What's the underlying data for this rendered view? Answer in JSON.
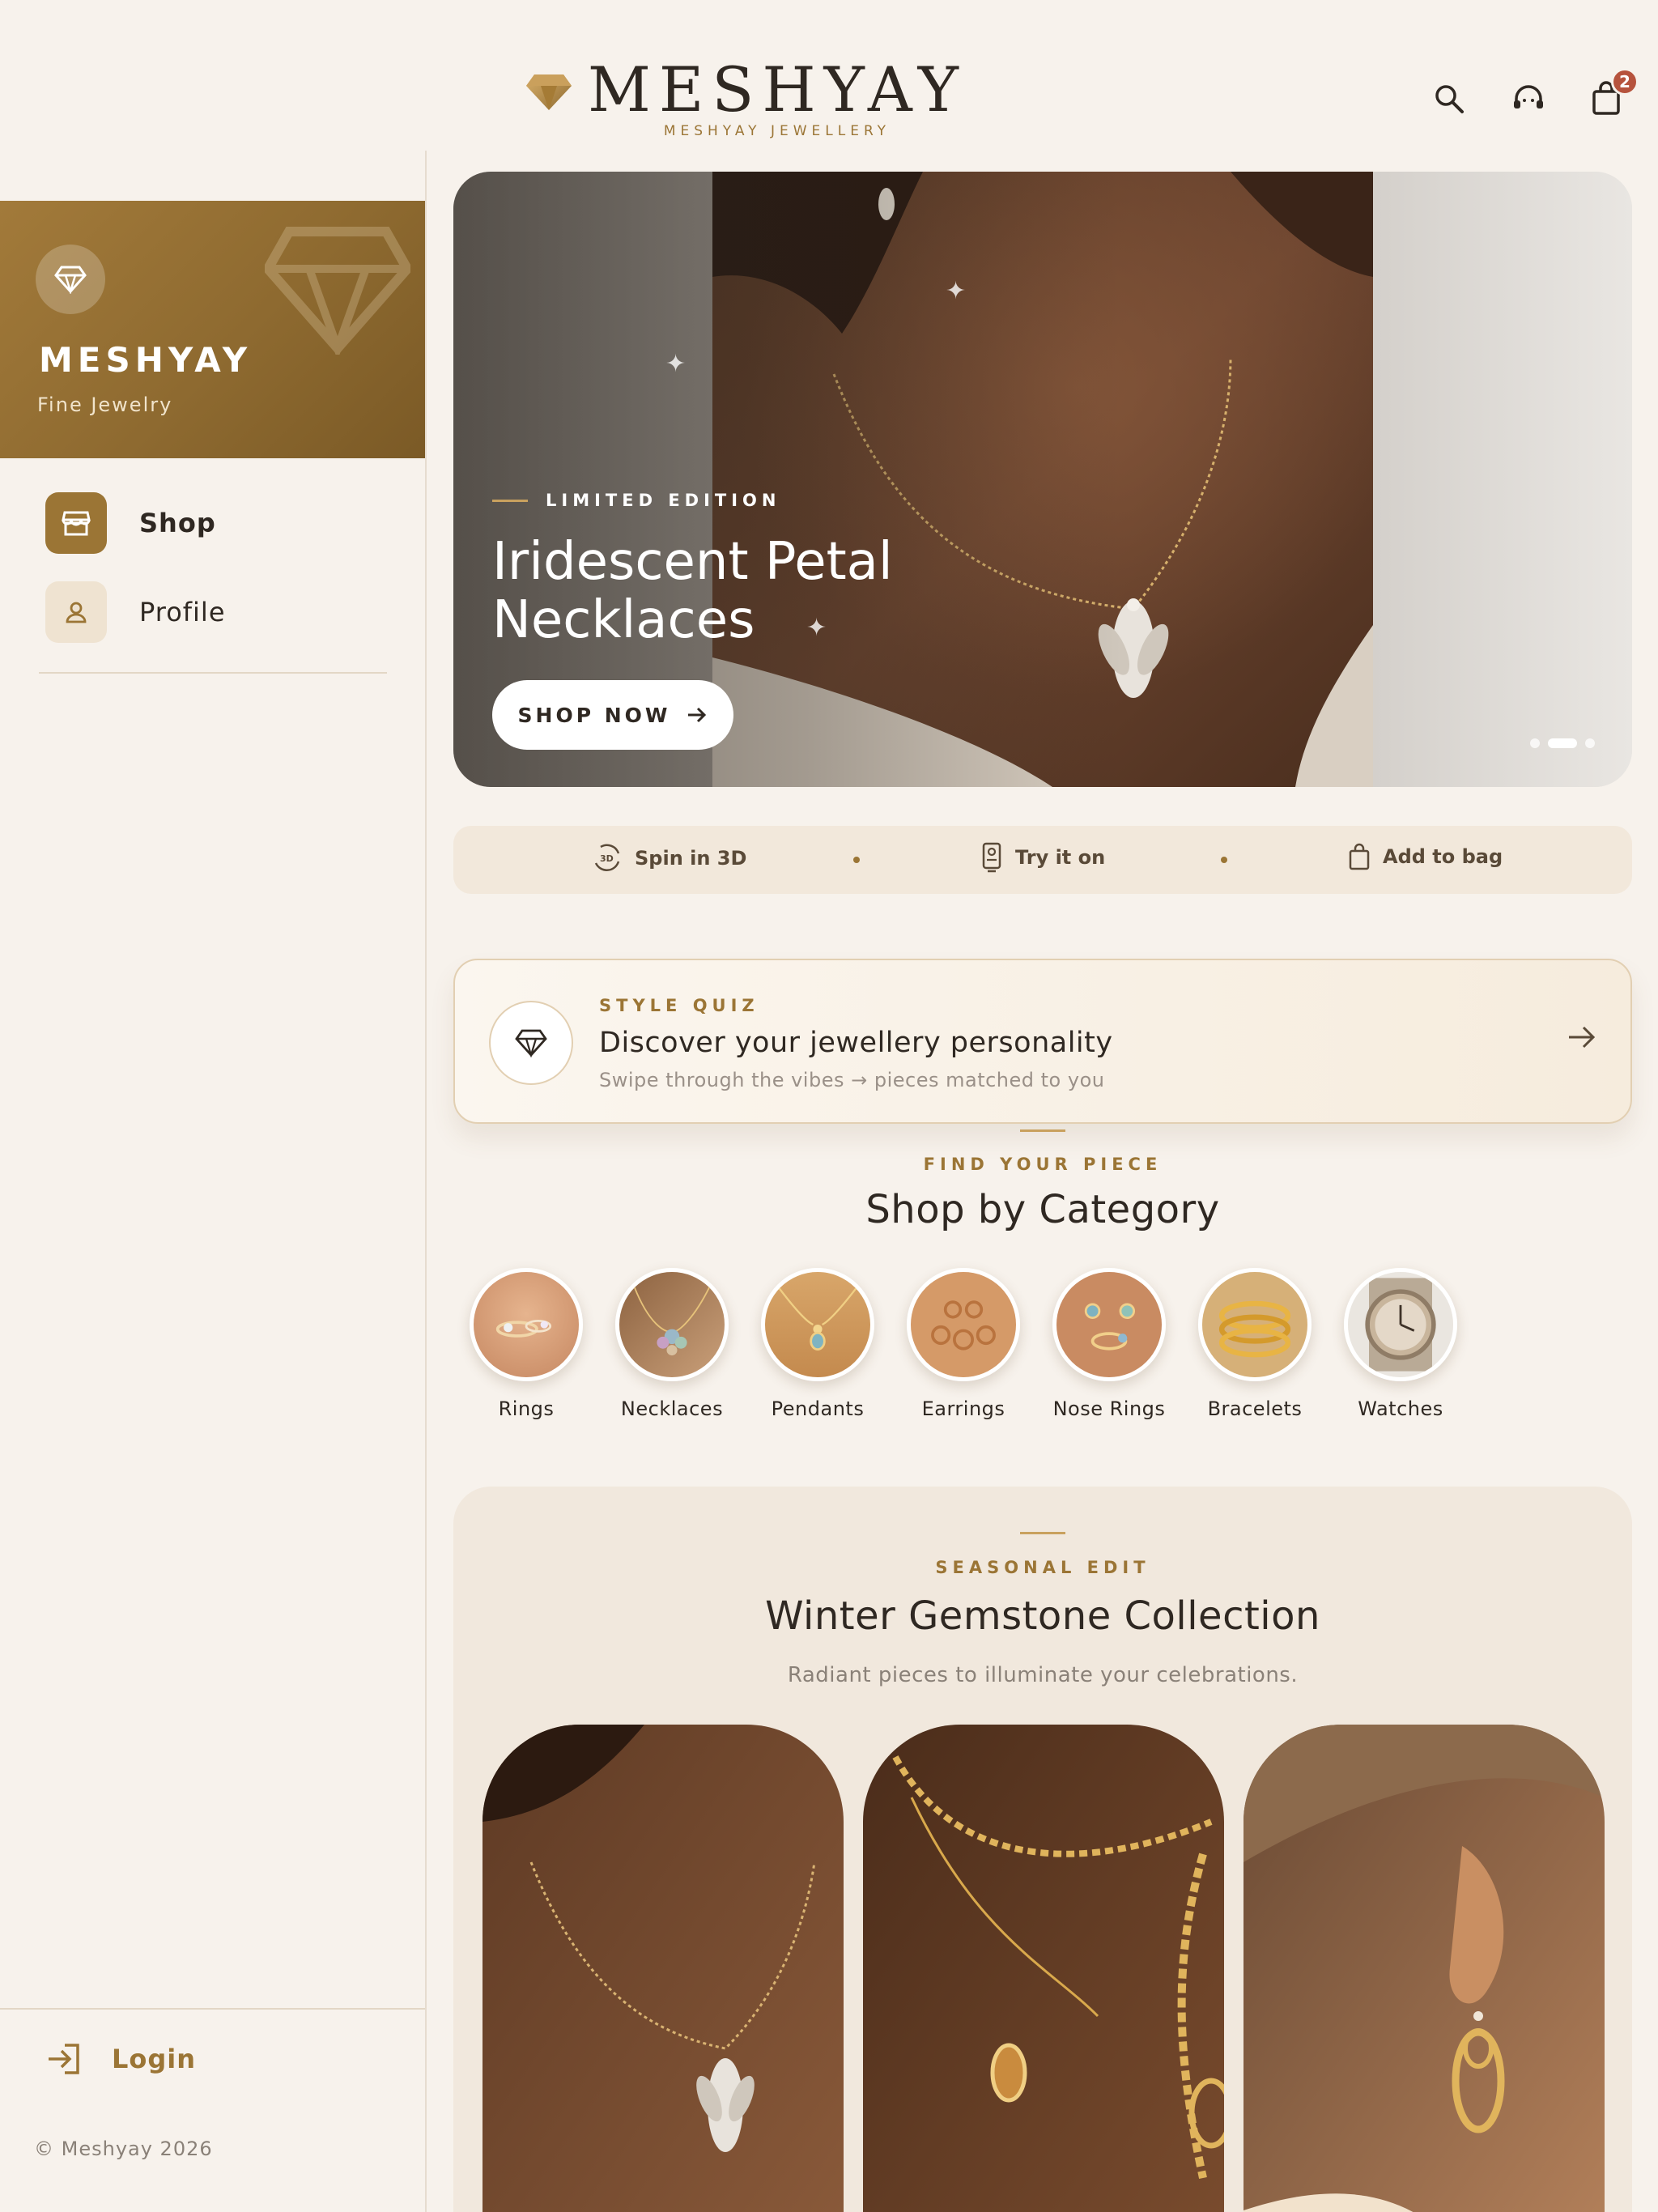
{
  "header": {
    "brand_name": "MESHYAY",
    "brand_sub": "MESHYAY JEWELLERY",
    "cart_count": "2",
    "icons": [
      "search-icon",
      "support-icon",
      "bag-icon"
    ]
  },
  "sidebar": {
    "brand_name": "MESHYAY",
    "tagline": "Fine Jewelry",
    "items": [
      {
        "label": "Shop",
        "icon": "store-icon",
        "active": true
      },
      {
        "label": "Profile",
        "icon": "user-icon",
        "active": false
      }
    ],
    "login_label": "Login",
    "copyright": "© Meshyay 2026"
  },
  "hero": {
    "eyebrow": "LIMITED EDITION",
    "title_line1": "Iridescent Petal",
    "title_line2": "Necklaces",
    "cta": "SHOP NOW",
    "slide_count": 3,
    "active_slide": 2
  },
  "features": [
    {
      "label": "Spin in 3D",
      "icon": "rotate-3d-icon"
    },
    {
      "label": "Try it on",
      "icon": "try-on-icon"
    },
    {
      "label": "Add to bag",
      "icon": "bag-icon"
    }
  ],
  "quiz": {
    "eyebrow": "STYLE QUIZ",
    "title": "Discover your jewellery personality",
    "subtitle": "Swipe through the vibes → pieces matched to you"
  },
  "categories": {
    "eyebrow": "FIND YOUR PIECE",
    "title": "Shop by Category",
    "items": [
      "Rings",
      "Necklaces",
      "Pendants",
      "Earrings",
      "Nose Rings",
      "Bracelets",
      "Watches"
    ]
  },
  "seasonal": {
    "eyebrow": "SEASONAL EDIT",
    "title": "Winter Gemstone Collection",
    "subtitle": "Radiant pieces to illuminate your celebrations."
  },
  "colors": {
    "accent": "#9b7535",
    "background": "#f7f2ec",
    "badge": "#b6533d",
    "text": "#2f2822"
  }
}
